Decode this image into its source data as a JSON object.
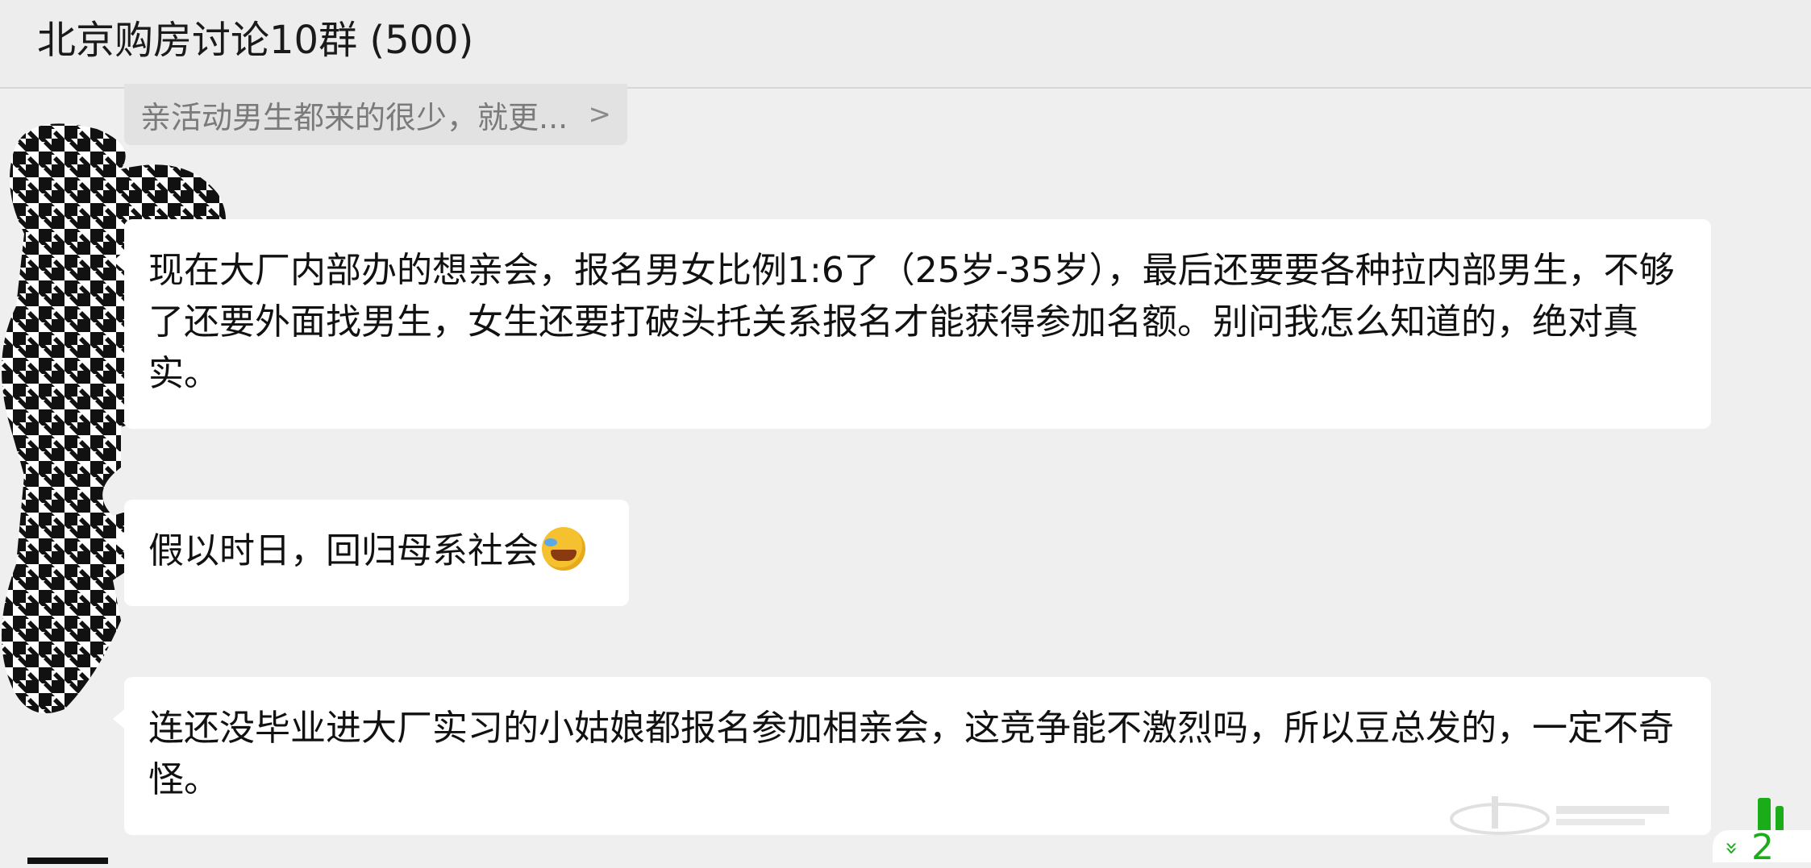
{
  "header": {
    "title": "北京购房讨论10群 (500)"
  },
  "quoted_reply": {
    "text": "亲活动男生都来的很少，就更...",
    "chevron": ">"
  },
  "messages": [
    {
      "text": "现在大厂内部办的想亲会，报名男女比例1:6了（25岁-35岁），最后还要要各种拉内部男生，不够了还要外面找男生，女生还要打破头托关系报名才能获得参加名额。别问我怎么知道的，绝对真实。"
    },
    {
      "text": "假以时日，回归母系社会",
      "emoji": "face-with-tears-of-joy"
    },
    {
      "text": "连还没毕业进大厂实习的小姑娘都报名参加相亲会，这竞争能不激烈吗，所以豆总发的，一定不奇怪。"
    }
  ],
  "new_messages_badge": {
    "count": "2",
    "color": "#1aad19"
  },
  "colors": {
    "background": "#efefef",
    "bubble": "#ffffff",
    "accent": "#1aad19"
  }
}
